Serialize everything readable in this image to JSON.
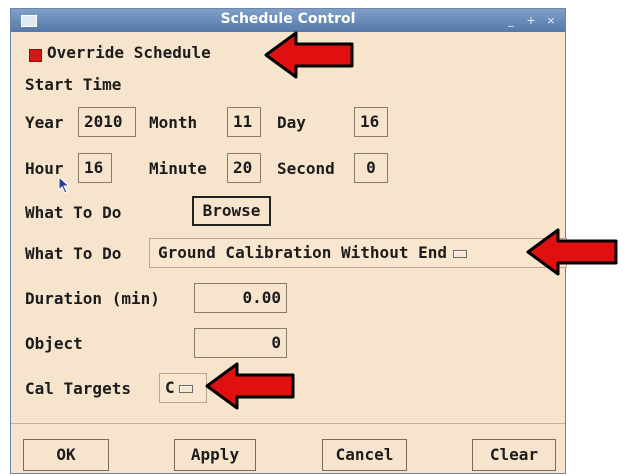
{
  "window": {
    "title": "Schedule Control",
    "title_buttons": [
      "_",
      "+",
      "×"
    ]
  },
  "override": {
    "label": "Override Schedule",
    "checked": true
  },
  "start_time": {
    "heading": "Start Time",
    "year_label": "Year",
    "year": "2010",
    "month_label": "Month",
    "month": "11",
    "day_label": "Day",
    "day": "16",
    "hour_label": "Hour",
    "hour": "16",
    "minute_label": "Minute",
    "minute": "20",
    "second_label": "Second",
    "second": "0"
  },
  "what_to_do_1": {
    "label": "What To Do",
    "button": "Browse"
  },
  "what_to_do_2": {
    "label": "What To Do",
    "value": "Ground Calibration Without End"
  },
  "duration": {
    "label": "Duration (min)",
    "value": "0.00"
  },
  "object": {
    "label": "Object",
    "value": "0"
  },
  "cal_targets": {
    "label": "Cal Targets",
    "value": "C"
  },
  "buttons": {
    "ok": "OK",
    "apply": "Apply",
    "cancel": "Cancel",
    "clear": "Clear"
  },
  "colors": {
    "dialog_bg": "#f7e4cc",
    "titlebar": "#5578a8",
    "arrow": "#e01010",
    "checkbox": "#d21818"
  },
  "icons": [
    "window-menu-icon",
    "minimize-icon",
    "maximize-icon",
    "close-icon",
    "pointer-cursor-icon",
    "annotation-arrow"
  ]
}
